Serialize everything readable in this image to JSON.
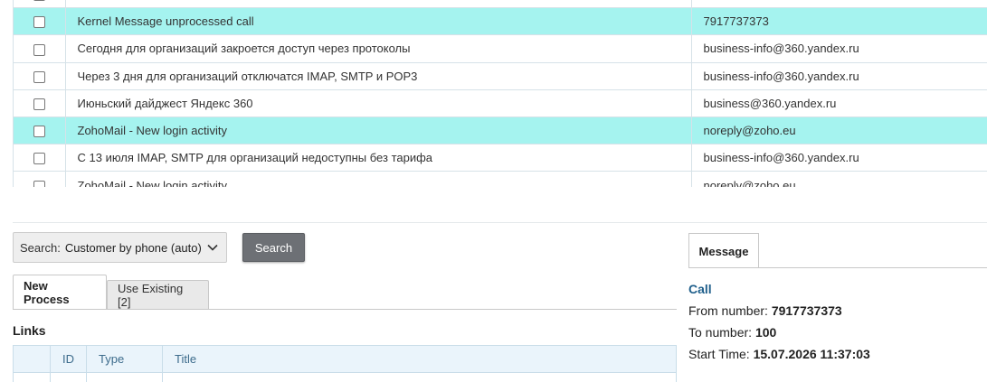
{
  "messages": [
    {
      "subject": "",
      "from": "",
      "highlight": false
    },
    {
      "subject": "Kernel Message unprocessed call",
      "from": "7917737373",
      "highlight": true
    },
    {
      "subject": "Сегодня для организаций закроется доступ через протоколы",
      "from": "business-info@360.yandex.ru",
      "highlight": false
    },
    {
      "subject": "Через 3 дня для организаций отключатся IMAP, SMTP и POP3",
      "from": "business-info@360.yandex.ru",
      "highlight": false
    },
    {
      "subject": "Июньский дайджест Яндекс 360",
      "from": "business@360.yandex.ru",
      "highlight": false
    },
    {
      "subject": "ZohoMail - New login activity",
      "from": "noreply@zoho.eu",
      "highlight": true
    },
    {
      "subject": "С 13 июля IMAP, SMTP для организаций недоступны без тарифа",
      "from": "business-info@360.yandex.ru",
      "highlight": false
    },
    {
      "subject": "ZohoMail - New login activity",
      "from": "noreply@zoho.eu",
      "highlight": false
    }
  ],
  "search": {
    "label": "Search:",
    "selected": "Customer by phone (auto)",
    "button": "Search"
  },
  "process_tabs": {
    "new_process": "New Process",
    "use_existing": "Use Existing [2]"
  },
  "links": {
    "title": "Links",
    "columns": [
      "",
      "ID",
      "Type",
      "Title"
    ]
  },
  "message_panel": {
    "tab": "Message",
    "type": "Call",
    "from_label": "From number:",
    "from_value": "7917737373",
    "to_label": "To number:",
    "to_value": "100",
    "start_label": "Start Time:",
    "start_value": "15.07.2026 11:37:03"
  },
  "colors": {
    "highlight_row": "#a5f3ef",
    "search_button": "#6d7075",
    "header_text": "#3d6c8c",
    "call_type": "#1f5f8b"
  }
}
